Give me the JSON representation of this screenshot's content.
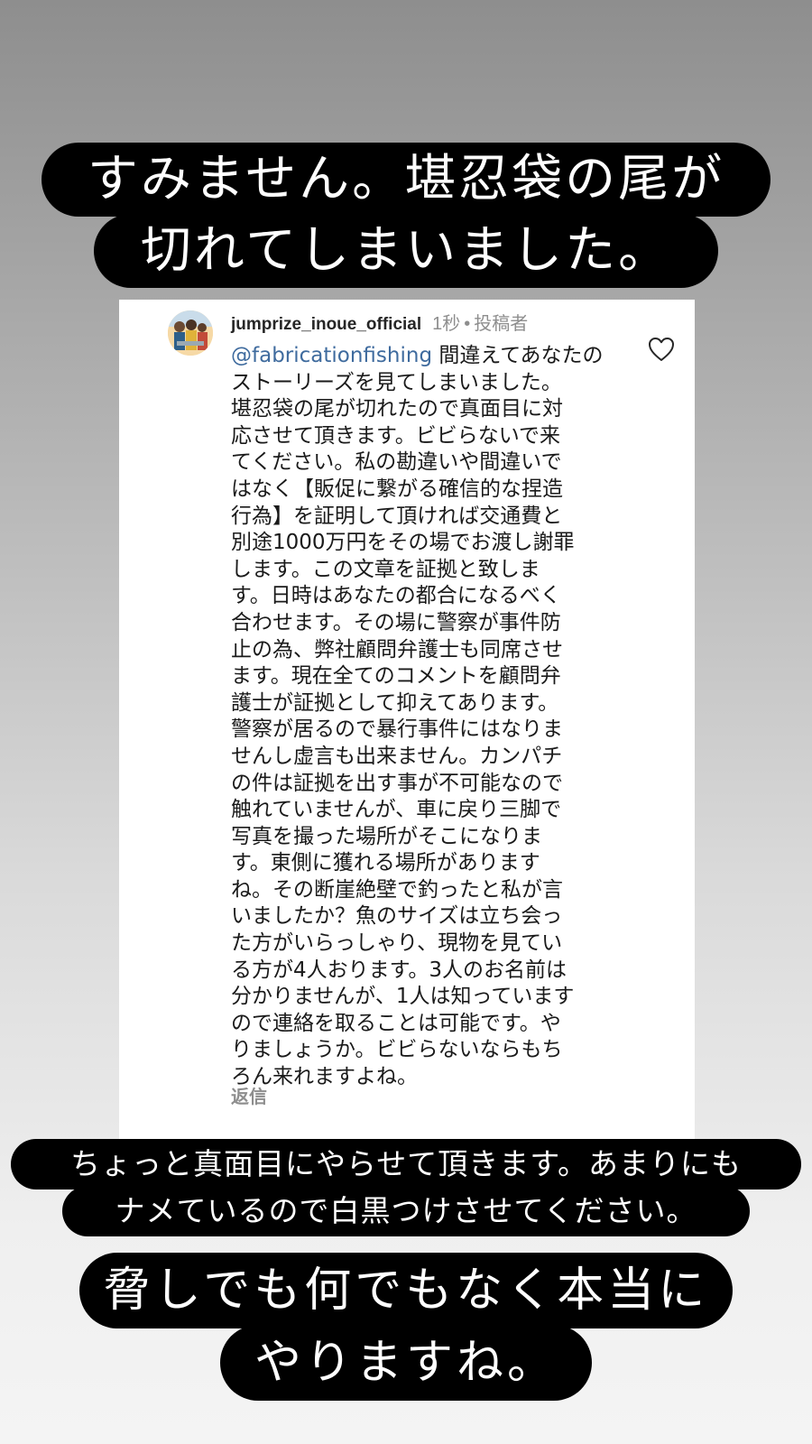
{
  "captions": {
    "top": {
      "line1": "すみません。堪忍袋の尾が",
      "line2": "切れてしまいました。"
    },
    "middle": {
      "line1": "ちょっと真面目にやらせて頂きます。あまりにも",
      "line2": "ナメているので白黒つけさせてください。"
    },
    "bottom": {
      "line1": "脅しでも何でもなく本当に",
      "line2": "やりますね。"
    }
  },
  "comment": {
    "username": "jumprize_inoue_official",
    "timestamp": "1秒",
    "separator": "•",
    "author_badge": "投稿者",
    "mention": "@fabricationfishing",
    "lines": [
      " 間違えてあなたの",
      "ストーリーズを見てしまいました。",
      "堪忍袋の尾が切れたので真面目に対",
      "応させて頂きます。ビビらないで来",
      "てください。私の勘違いや間違いで",
      "はなく【販促に繋がる確信的な捏造",
      "行為】を証明して頂ければ交通費と",
      "別途1000万円をその場でお渡し謝罪",
      "します。この文章を証拠と致しま",
      "す。日時はあなたの都合になるべく",
      "合わせます。その場に警察が事件防",
      "止の為、弊社顧問弁護士も同席させ",
      "ます。現在全てのコメントを顧問弁",
      "護士が証拠として抑えてあります。",
      "警察が居るので暴行事件にはなりま",
      "せんし虚言も出来ません。カンパチ",
      "の件は証拠を出す事が不可能なので",
      "触れていませんが、車に戻り三脚で",
      "写真を撮った場所がそこになりま",
      "す。東側に獲れる場所があります",
      "ね。その断崖絶壁で釣ったと私が言",
      "いましたか？魚のサイズは立ち会っ",
      "た方がいらっしゃり、現物を見てい",
      "る方が4人おります。3人のお名前は",
      "分かりませんが、1人は知っています",
      "ので連絡を取ることは可能です。や",
      "りましょうか。ビビらないならもち",
      "ろん来れますよね。"
    ],
    "reply_label": "返信",
    "like_icon": "heart-outline-icon"
  },
  "colors": {
    "pill_bg": "#000000",
    "pill_text": "#ffffff",
    "mention": "#3f6b9e",
    "meta_text": "#8e8e8e"
  }
}
